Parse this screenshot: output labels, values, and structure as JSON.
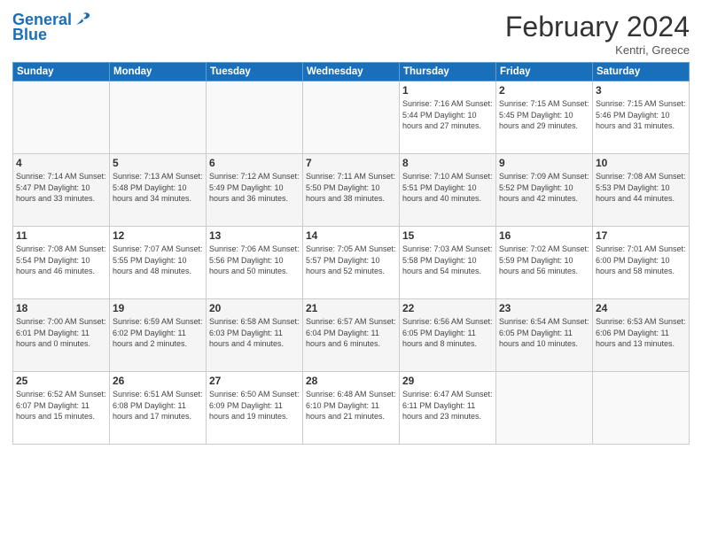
{
  "logo": {
    "line1": "General",
    "line2": "Blue"
  },
  "title": "February 2024",
  "location": "Kentri, Greece",
  "headers": [
    "Sunday",
    "Monday",
    "Tuesday",
    "Wednesday",
    "Thursday",
    "Friday",
    "Saturday"
  ],
  "weeks": [
    [
      {
        "day": "",
        "info": ""
      },
      {
        "day": "",
        "info": ""
      },
      {
        "day": "",
        "info": ""
      },
      {
        "day": "",
        "info": ""
      },
      {
        "day": "1",
        "info": "Sunrise: 7:16 AM\nSunset: 5:44 PM\nDaylight: 10 hours\nand 27 minutes."
      },
      {
        "day": "2",
        "info": "Sunrise: 7:15 AM\nSunset: 5:45 PM\nDaylight: 10 hours\nand 29 minutes."
      },
      {
        "day": "3",
        "info": "Sunrise: 7:15 AM\nSunset: 5:46 PM\nDaylight: 10 hours\nand 31 minutes."
      }
    ],
    [
      {
        "day": "4",
        "info": "Sunrise: 7:14 AM\nSunset: 5:47 PM\nDaylight: 10 hours\nand 33 minutes."
      },
      {
        "day": "5",
        "info": "Sunrise: 7:13 AM\nSunset: 5:48 PM\nDaylight: 10 hours\nand 34 minutes."
      },
      {
        "day": "6",
        "info": "Sunrise: 7:12 AM\nSunset: 5:49 PM\nDaylight: 10 hours\nand 36 minutes."
      },
      {
        "day": "7",
        "info": "Sunrise: 7:11 AM\nSunset: 5:50 PM\nDaylight: 10 hours\nand 38 minutes."
      },
      {
        "day": "8",
        "info": "Sunrise: 7:10 AM\nSunset: 5:51 PM\nDaylight: 10 hours\nand 40 minutes."
      },
      {
        "day": "9",
        "info": "Sunrise: 7:09 AM\nSunset: 5:52 PM\nDaylight: 10 hours\nand 42 minutes."
      },
      {
        "day": "10",
        "info": "Sunrise: 7:08 AM\nSunset: 5:53 PM\nDaylight: 10 hours\nand 44 minutes."
      }
    ],
    [
      {
        "day": "11",
        "info": "Sunrise: 7:08 AM\nSunset: 5:54 PM\nDaylight: 10 hours\nand 46 minutes."
      },
      {
        "day": "12",
        "info": "Sunrise: 7:07 AM\nSunset: 5:55 PM\nDaylight: 10 hours\nand 48 minutes."
      },
      {
        "day": "13",
        "info": "Sunrise: 7:06 AM\nSunset: 5:56 PM\nDaylight: 10 hours\nand 50 minutes."
      },
      {
        "day": "14",
        "info": "Sunrise: 7:05 AM\nSunset: 5:57 PM\nDaylight: 10 hours\nand 52 minutes."
      },
      {
        "day": "15",
        "info": "Sunrise: 7:03 AM\nSunset: 5:58 PM\nDaylight: 10 hours\nand 54 minutes."
      },
      {
        "day": "16",
        "info": "Sunrise: 7:02 AM\nSunset: 5:59 PM\nDaylight: 10 hours\nand 56 minutes."
      },
      {
        "day": "17",
        "info": "Sunrise: 7:01 AM\nSunset: 6:00 PM\nDaylight: 10 hours\nand 58 minutes."
      }
    ],
    [
      {
        "day": "18",
        "info": "Sunrise: 7:00 AM\nSunset: 6:01 PM\nDaylight: 11 hours\nand 0 minutes."
      },
      {
        "day": "19",
        "info": "Sunrise: 6:59 AM\nSunset: 6:02 PM\nDaylight: 11 hours\nand 2 minutes."
      },
      {
        "day": "20",
        "info": "Sunrise: 6:58 AM\nSunset: 6:03 PM\nDaylight: 11 hours\nand 4 minutes."
      },
      {
        "day": "21",
        "info": "Sunrise: 6:57 AM\nSunset: 6:04 PM\nDaylight: 11 hours\nand 6 minutes."
      },
      {
        "day": "22",
        "info": "Sunrise: 6:56 AM\nSunset: 6:05 PM\nDaylight: 11 hours\nand 8 minutes."
      },
      {
        "day": "23",
        "info": "Sunrise: 6:54 AM\nSunset: 6:05 PM\nDaylight: 11 hours\nand 10 minutes."
      },
      {
        "day": "24",
        "info": "Sunrise: 6:53 AM\nSunset: 6:06 PM\nDaylight: 11 hours\nand 13 minutes."
      }
    ],
    [
      {
        "day": "25",
        "info": "Sunrise: 6:52 AM\nSunset: 6:07 PM\nDaylight: 11 hours\nand 15 minutes."
      },
      {
        "day": "26",
        "info": "Sunrise: 6:51 AM\nSunset: 6:08 PM\nDaylight: 11 hours\nand 17 minutes."
      },
      {
        "day": "27",
        "info": "Sunrise: 6:50 AM\nSunset: 6:09 PM\nDaylight: 11 hours\nand 19 minutes."
      },
      {
        "day": "28",
        "info": "Sunrise: 6:48 AM\nSunset: 6:10 PM\nDaylight: 11 hours\nand 21 minutes."
      },
      {
        "day": "29",
        "info": "Sunrise: 6:47 AM\nSunset: 6:11 PM\nDaylight: 11 hours\nand 23 minutes."
      },
      {
        "day": "",
        "info": ""
      },
      {
        "day": "",
        "info": ""
      }
    ]
  ]
}
